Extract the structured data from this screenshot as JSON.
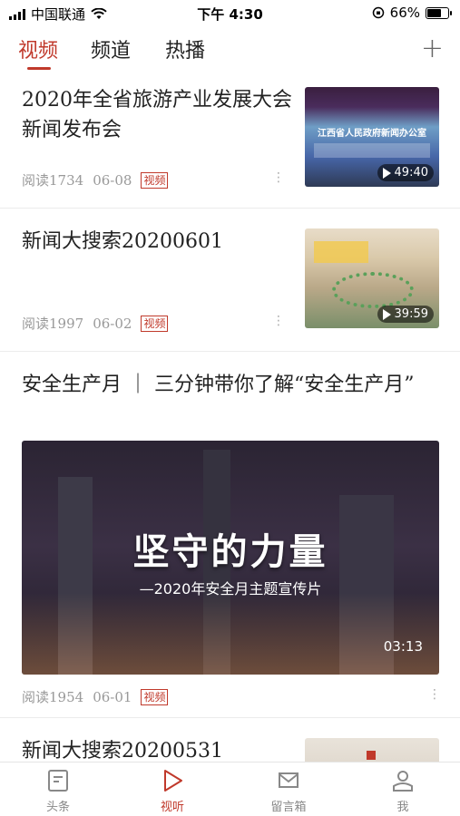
{
  "status_bar": {
    "carrier": "中国联通",
    "time": "下午 4:30",
    "battery": "66%",
    "battery_level": 0.66
  },
  "tabs": [
    {
      "label": "视频"
    },
    {
      "label": "频道"
    },
    {
      "label": "热播"
    }
  ],
  "add_tab": "+",
  "feed": [
    {
      "title": "2020年全省旅游产业发展大会新闻发布会",
      "reads": "阅读1734",
      "date": "06-08",
      "badge": "视频",
      "duration": "49:40",
      "thumb_text": "江西省人民政府新闻办公室"
    },
    {
      "title": "新闻大搜索20200601",
      "reads": "阅读1997",
      "date": "06-02",
      "badge": "视频",
      "duration": "39:59"
    },
    {
      "title": "安全生产月 ｜ 三分钟带你了解“安全生产月”",
      "reads": "阅读1954",
      "date": "06-01",
      "badge": "视频",
      "duration": "03:13",
      "video_title": "坚守的力量",
      "video_subtitle": "—2020年安全月主题宣传片"
    },
    {
      "title": "新闻大搜索20200531"
    }
  ],
  "bottom_nav": [
    {
      "label": "头条",
      "icon": "news-icon"
    },
    {
      "label": "视听",
      "icon": "play-icon"
    },
    {
      "label": "留言箱",
      "icon": "mail-icon"
    },
    {
      "label": "我",
      "icon": "user-icon"
    }
  ],
  "colors": {
    "accent": "#c0392b",
    "text": "#222222",
    "meta": "#999999"
  }
}
